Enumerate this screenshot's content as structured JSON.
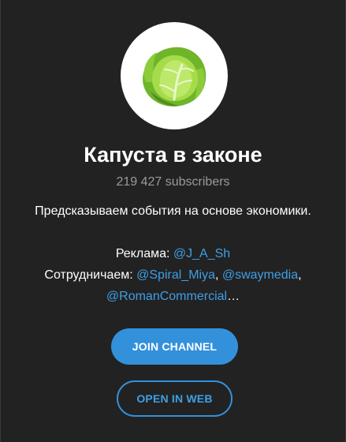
{
  "channel": {
    "name": "Капуста в законе",
    "subscribers": "219 427 subscribers",
    "avatar_icon": "cabbage-icon"
  },
  "description": {
    "line1": "Предсказываем события на основе экономики.",
    "ads_label": "Реклама: ",
    "ads_link": "@J_A_Sh",
    "collab_label": "Сотрудничаем: ",
    "collab_link1": "@Spiral_Miya",
    "sep1": ", ",
    "collab_link2": "@swaymedia",
    "sep2": ",",
    "collab_link3": "@RomanCommercial",
    "ellipsis": "…"
  },
  "actions": {
    "join_label": "JOIN CHANNEL",
    "open_web_label": "OPEN IN WEB"
  },
  "colors": {
    "background": "#222222",
    "accent": "#3391db",
    "link": "#3e9fe6",
    "muted": "#9a9a9a"
  }
}
